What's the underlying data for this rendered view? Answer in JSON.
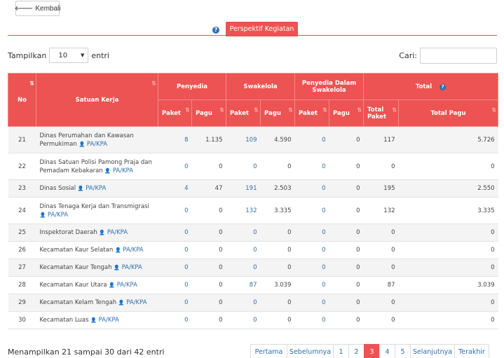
{
  "back_button": {
    "label": "Kembali"
  },
  "tabs": {
    "active_label": "Perspektif Kegiatan"
  },
  "length": {
    "prefix": "Tampilkan",
    "value": "10",
    "suffix": "entri"
  },
  "search": {
    "label": "Cari:",
    "value": ""
  },
  "table": {
    "headers": {
      "no": "No",
      "satker": "Satuan Kerja",
      "penyedia": "Penyedia",
      "swakelola": "Swakelola",
      "penyedia_swakelola": "Penyedia Dalam Swakelola",
      "total": "Total",
      "paket": "Paket",
      "pagu": "Pagu",
      "total_paket": "Total Paket",
      "total_pagu": "Total Pagu"
    },
    "ppk_label": "PA/KPA",
    "rows": [
      {
        "no": "21",
        "name": "Dinas Perumahan dan Kawasan Permukiman",
        "p_paket": "8",
        "p_pagu": "1.135",
        "s_paket": "109",
        "s_pagu": "4.590",
        "ps_paket": "0",
        "ps_pagu": "0",
        "t_paket": "117",
        "t_pagu": "5.726"
      },
      {
        "no": "22",
        "name": "Dinas Satuan Polisi Pamong Praja dan Pemadam Kebakaran",
        "p_paket": "0",
        "p_pagu": "0",
        "s_paket": "0",
        "s_pagu": "0",
        "ps_paket": "0",
        "ps_pagu": "0",
        "t_paket": "0",
        "t_pagu": "0"
      },
      {
        "no": "23",
        "name": "Dinas Sosial",
        "p_paket": "4",
        "p_pagu": "47",
        "s_paket": "191",
        "s_pagu": "2.503",
        "ps_paket": "0",
        "ps_pagu": "0",
        "t_paket": "195",
        "t_pagu": "2.550"
      },
      {
        "no": "24",
        "name": "Dinas Tenaga Kerja dan Transmigrasi",
        "p_paket": "0",
        "p_pagu": "0",
        "s_paket": "132",
        "s_pagu": "3.335",
        "ps_paket": "0",
        "ps_pagu": "0",
        "t_paket": "132",
        "t_pagu": "3.335"
      },
      {
        "no": "25",
        "name": "Inspektorat Daerah",
        "p_paket": "0",
        "p_pagu": "0",
        "s_paket": "0",
        "s_pagu": "0",
        "ps_paket": "0",
        "ps_pagu": "0",
        "t_paket": "0",
        "t_pagu": "0"
      },
      {
        "no": "26",
        "name": "Kecamatan Kaur Selatan",
        "p_paket": "0",
        "p_pagu": "0",
        "s_paket": "0",
        "s_pagu": "0",
        "ps_paket": "0",
        "ps_pagu": "0",
        "t_paket": "0",
        "t_pagu": "0"
      },
      {
        "no": "27",
        "name": "Kecamatan Kaur Tengah",
        "p_paket": "0",
        "p_pagu": "0",
        "s_paket": "0",
        "s_pagu": "0",
        "ps_paket": "0",
        "ps_pagu": "0",
        "t_paket": "0",
        "t_pagu": "0"
      },
      {
        "no": "28",
        "name": "Kecamatan Kaur Utara",
        "p_paket": "0",
        "p_pagu": "0",
        "s_paket": "87",
        "s_pagu": "3.039",
        "ps_paket": "0",
        "ps_pagu": "0",
        "t_paket": "87",
        "t_pagu": "3.039"
      },
      {
        "no": "29",
        "name": "Kecamatan Kelam Tengah",
        "p_paket": "0",
        "p_pagu": "0",
        "s_paket": "0",
        "s_pagu": "0",
        "ps_paket": "0",
        "ps_pagu": "0",
        "t_paket": "0",
        "t_pagu": "0"
      },
      {
        "no": "30",
        "name": "Kecamatan Luas",
        "p_paket": "0",
        "p_pagu": "0",
        "s_paket": "0",
        "s_pagu": "0",
        "ps_paket": "0",
        "ps_pagu": "0",
        "t_paket": "0",
        "t_pagu": "0"
      }
    ]
  },
  "info": "Menampilkan 21 sampai 30 dari 42 entri",
  "pagination": {
    "first": "Pertama",
    "prev": "Sebelumnya",
    "pages": [
      "1",
      "2",
      "3",
      "4",
      "5"
    ],
    "current": "3",
    "next": "Selanjutnya",
    "last": "Terakhir"
  },
  "colors": {
    "accent": "#ec5352",
    "link": "#2f6fad"
  }
}
